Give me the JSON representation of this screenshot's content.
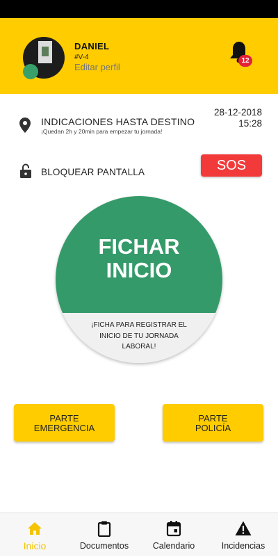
{
  "header": {
    "user_name": "DANIEL",
    "user_code": "#V-4",
    "edit_profile": "Editar perfil",
    "notifications_count": "12",
    "accent_color": "#ffcc00"
  },
  "info": {
    "destination_label": "INDICACIONES HASTA DESTINO",
    "destination_sub": "¡Quedan 2h y 20min para empezar tu jornada!",
    "date": "28-12-2018",
    "time": "15:28",
    "lock_label": "BLOQUEAR PANTALLA",
    "sos_label": "SOS"
  },
  "clock": {
    "title_line1": "FICHAR",
    "title_line2": "INICIO",
    "hint": "¡FICHA PARA REGISTRAR EL INICIO DE TU JORNADA LABORAL!",
    "color": "#359a6a"
  },
  "actions": {
    "emergency_line1": "PARTE",
    "emergency_line2": "EMERGENCIA",
    "police_line1": "PARTE",
    "police_line2": "POLICÍA"
  },
  "nav": {
    "items": [
      {
        "label": "Inicio",
        "icon": "home-icon",
        "active": true
      },
      {
        "label": "Documentos",
        "icon": "clipboard-icon",
        "active": false
      },
      {
        "label": "Calendario",
        "icon": "calendar-icon",
        "active": false
      },
      {
        "label": "Incidencias",
        "icon": "warning-icon",
        "active": false
      }
    ]
  }
}
